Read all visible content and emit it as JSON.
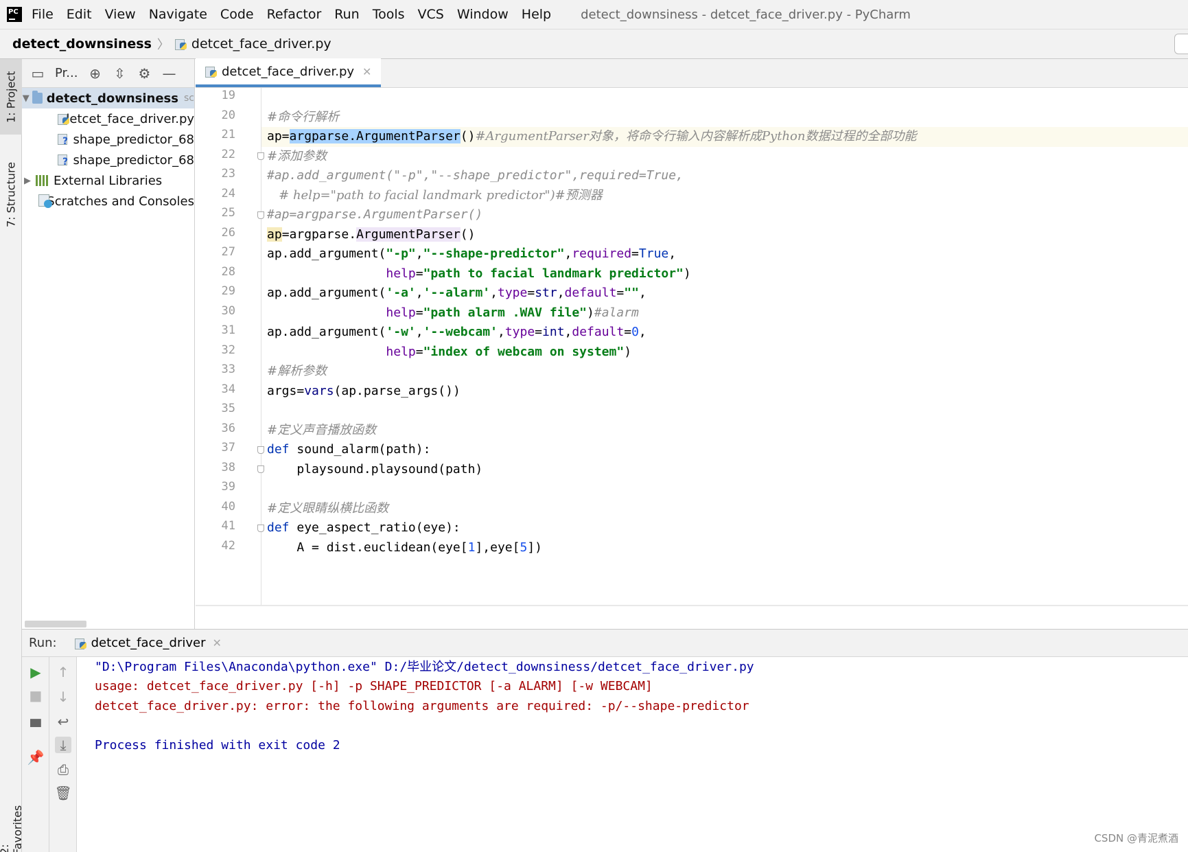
{
  "menubar": {
    "items": [
      "File",
      "Edit",
      "View",
      "Navigate",
      "Code",
      "Refactor",
      "Run",
      "Tools",
      "VCS",
      "Window",
      "Help"
    ],
    "window_title": "detect_downsiness - detcet_face_driver.py - PyCharm"
  },
  "navbar": {
    "project": "detect_downsiness",
    "file": "detcet_face_driver.py"
  },
  "left_strip": {
    "project_tab": "1: Project",
    "structure_tab": "7: Structure",
    "favorites_tab": "2: Favorites"
  },
  "project_panel": {
    "toolbar_title": "Pr...",
    "tree": [
      {
        "label": "detect_downsiness",
        "suffix": "sc",
        "type": "folder"
      },
      {
        "label": "detcet_face_driver.py",
        "type": "py"
      },
      {
        "label": "shape_predictor_68",
        "type": "unknown"
      },
      {
        "label": "shape_predictor_68",
        "type": "unknown"
      },
      {
        "label": "External Libraries",
        "type": "lib"
      },
      {
        "label": "Scratches and Consoles",
        "type": "scratch"
      }
    ]
  },
  "editor": {
    "tab_label": "detcet_face_driver.py",
    "line_numbers": [
      "19",
      "20",
      "21",
      "22",
      "23",
      "24",
      "25",
      "26",
      "27",
      "28",
      "29",
      "30",
      "31",
      "32",
      "33",
      "34",
      "35",
      "36",
      "37",
      "38",
      "39",
      "40",
      "41",
      "42"
    ]
  },
  "run_panel": {
    "label": "Run:",
    "tab": "detcet_face_driver",
    "console": [
      "\"D:\\Program Files\\Anaconda\\python.exe\" D:/毕业论文/detect_downsiness/detcet_face_driver.py",
      "usage: detcet_face_driver.py [-h] -p SHAPE_PREDICTOR [-a ALARM] [-w WEBCAM]",
      "detcet_face_driver.py: error: the following arguments are required: -p/--shape-predictor",
      "",
      "Process finished with exit code 2"
    ]
  },
  "watermark": "CSDN @青泥煮酒"
}
